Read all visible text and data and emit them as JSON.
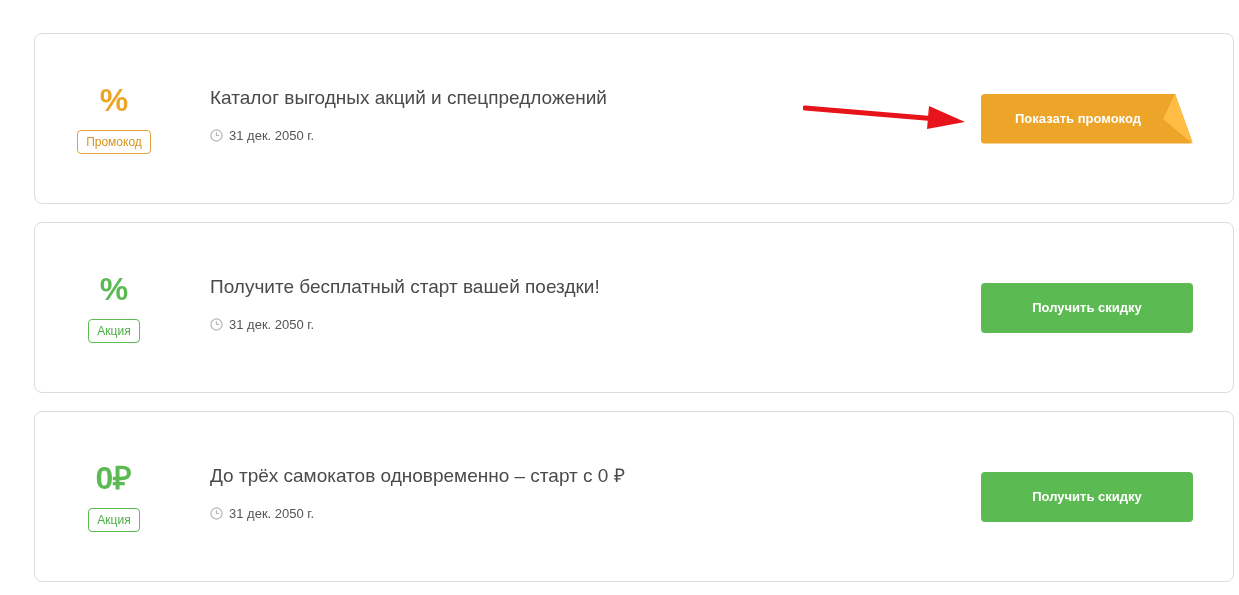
{
  "offers": [
    {
      "kind": "promo",
      "symbol": "%",
      "tag": "Промокод",
      "title": "Каталог выгодных акций и спецпредложений",
      "date": "31 дек. 2050 г.",
      "button": "Показать промокод"
    },
    {
      "kind": "deal",
      "symbol": "%",
      "tag": "Акция",
      "title": "Получите бесплатный старт вашей поездки!",
      "date": "31 дек. 2050 г.",
      "button": "Получить скидку"
    },
    {
      "kind": "deal",
      "symbol": "0₽",
      "tag": "Акция",
      "title": "До трёх самокатов одновременно – старт с 0 ₽",
      "date": "31 дек. 2050 г.",
      "button": "Получить скидку"
    }
  ]
}
